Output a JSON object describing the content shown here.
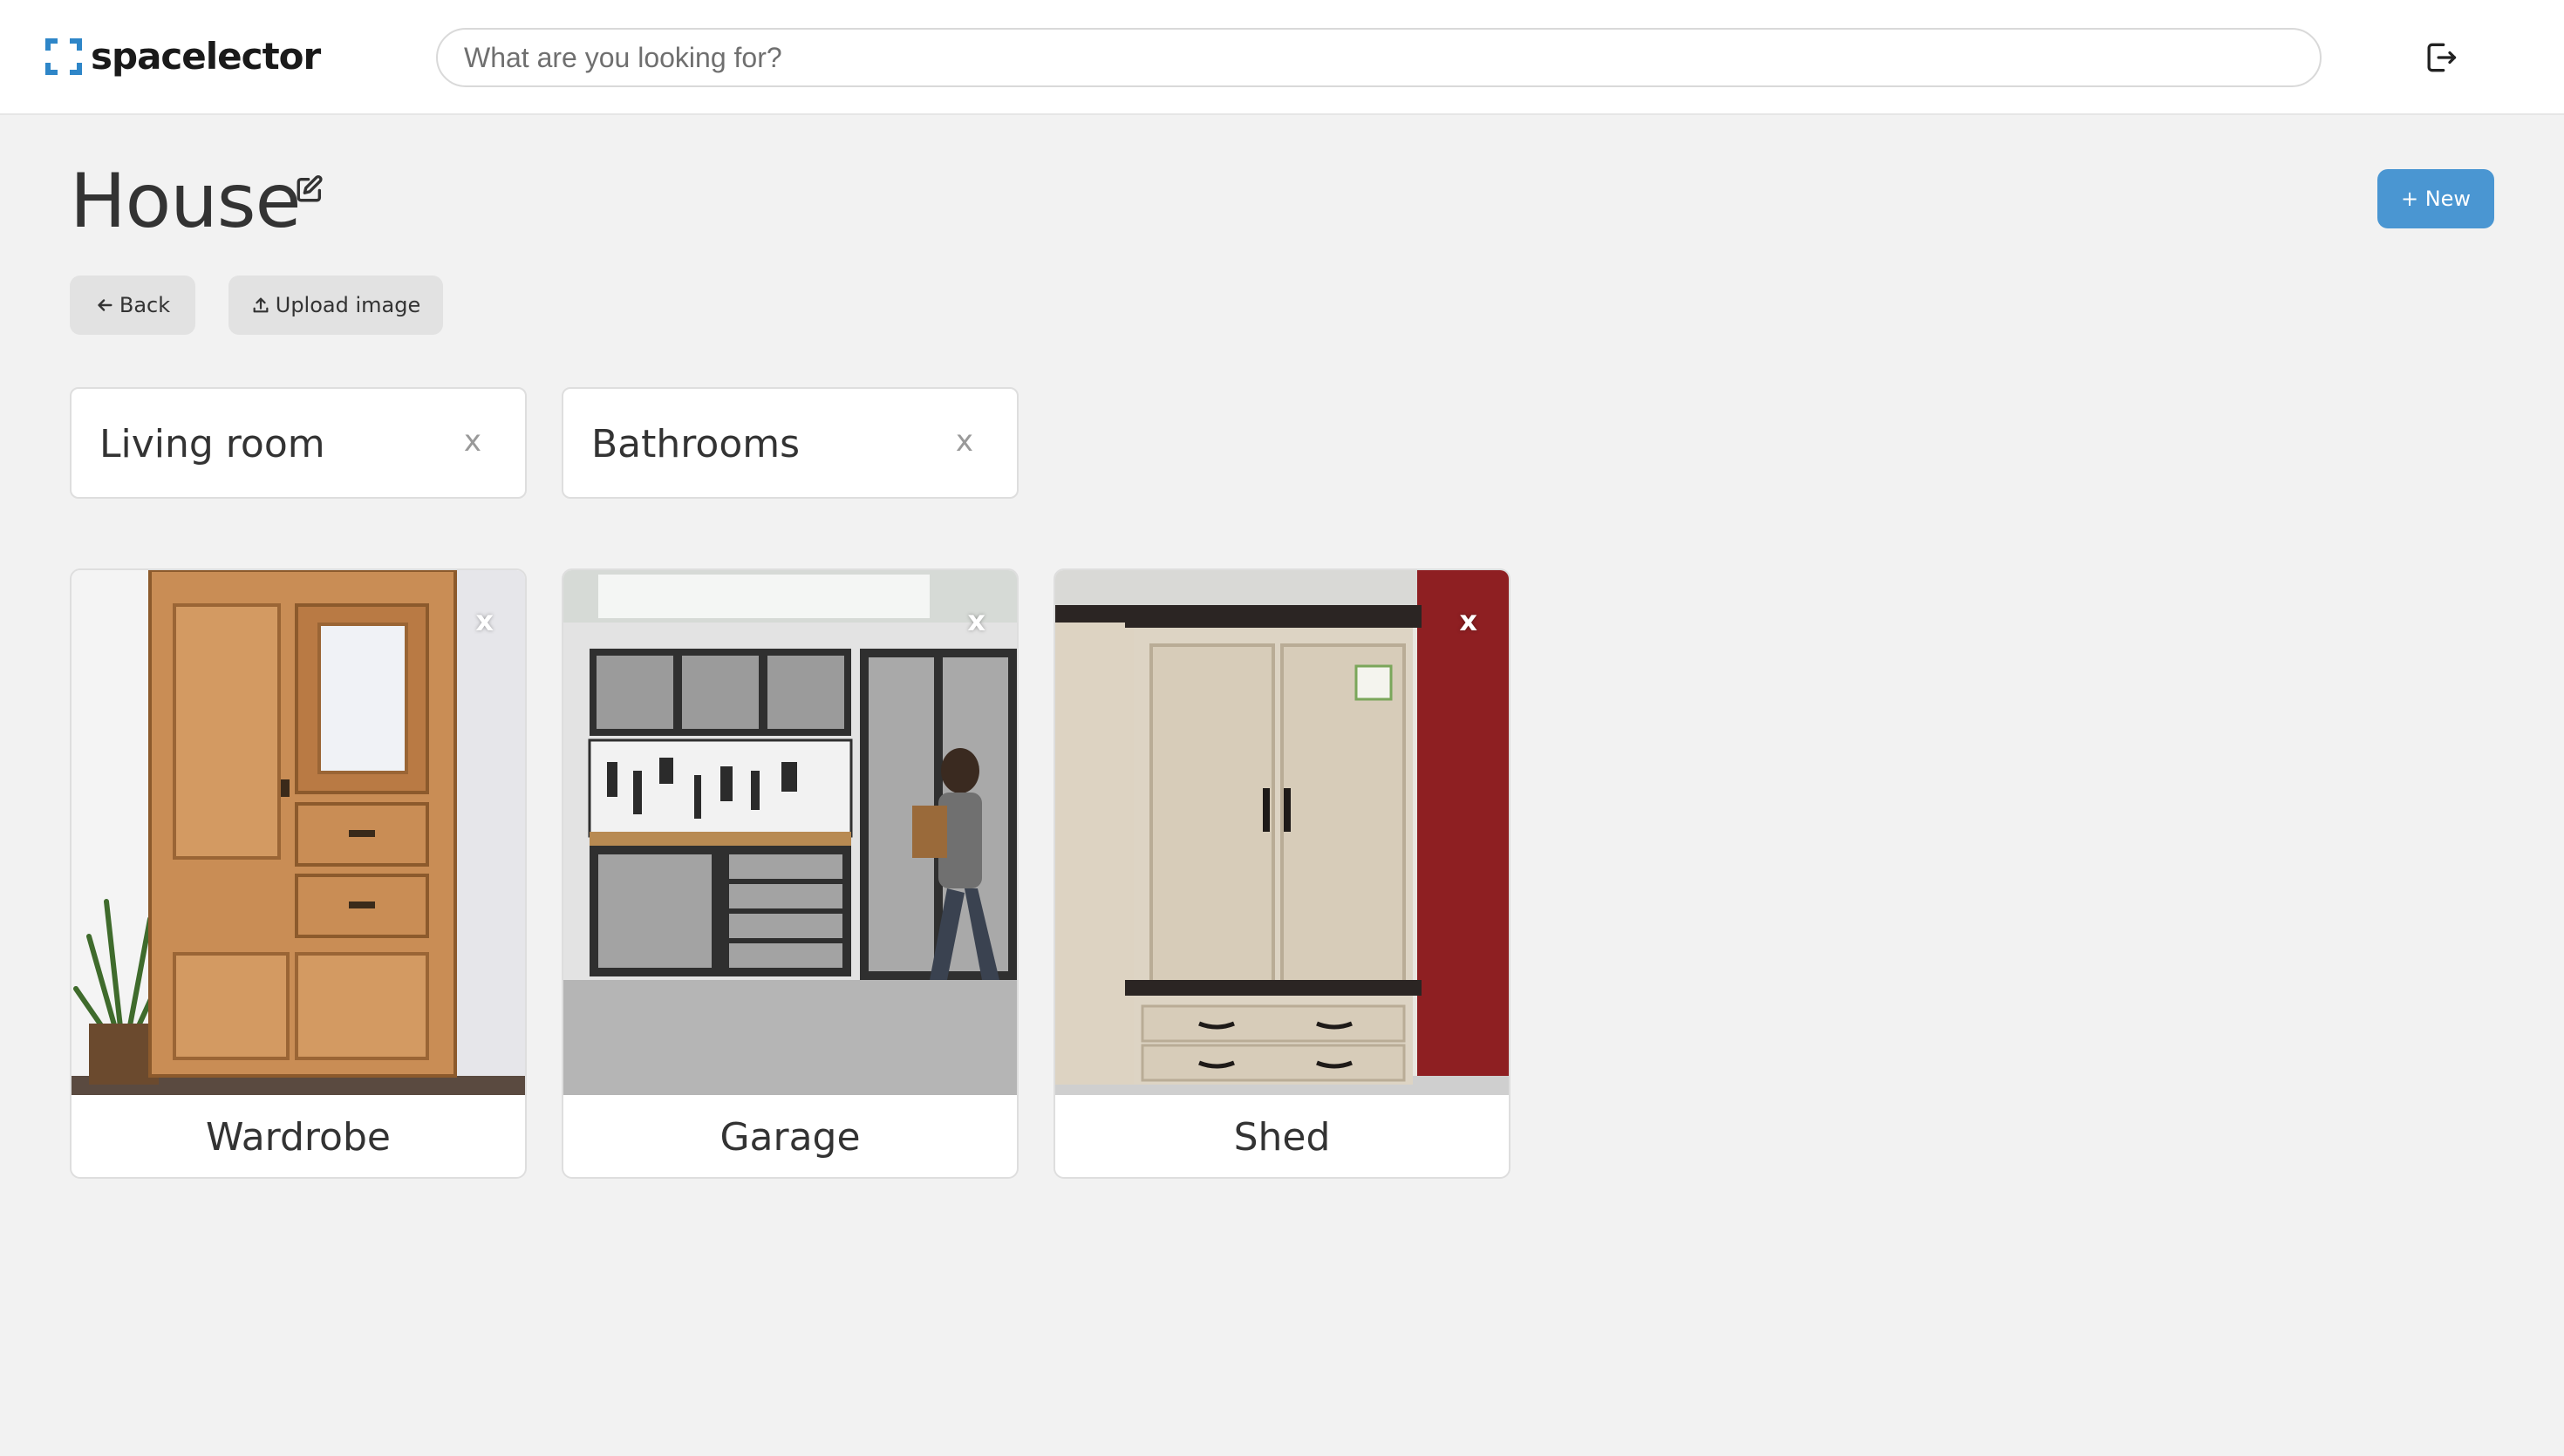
{
  "app": {
    "brand": "spacelector"
  },
  "header": {
    "search_placeholder": "What are you looking for?",
    "logout_icon": "logout-icon"
  },
  "page": {
    "title": "House",
    "new_label": "+ New",
    "back_label": "Back",
    "upload_label": "Upload image"
  },
  "folders": [
    {
      "name": "Living room",
      "remove": "x"
    },
    {
      "name": "Bathrooms",
      "remove": "x"
    }
  ],
  "cards": [
    {
      "name": "Wardrobe",
      "remove": "x"
    },
    {
      "name": "Garage",
      "remove": "x"
    },
    {
      "name": "Shed",
      "remove": "x"
    }
  ],
  "colors": {
    "accent": "#4a96d2",
    "brand": "#2e86c8",
    "background": "#f2f2f2"
  }
}
